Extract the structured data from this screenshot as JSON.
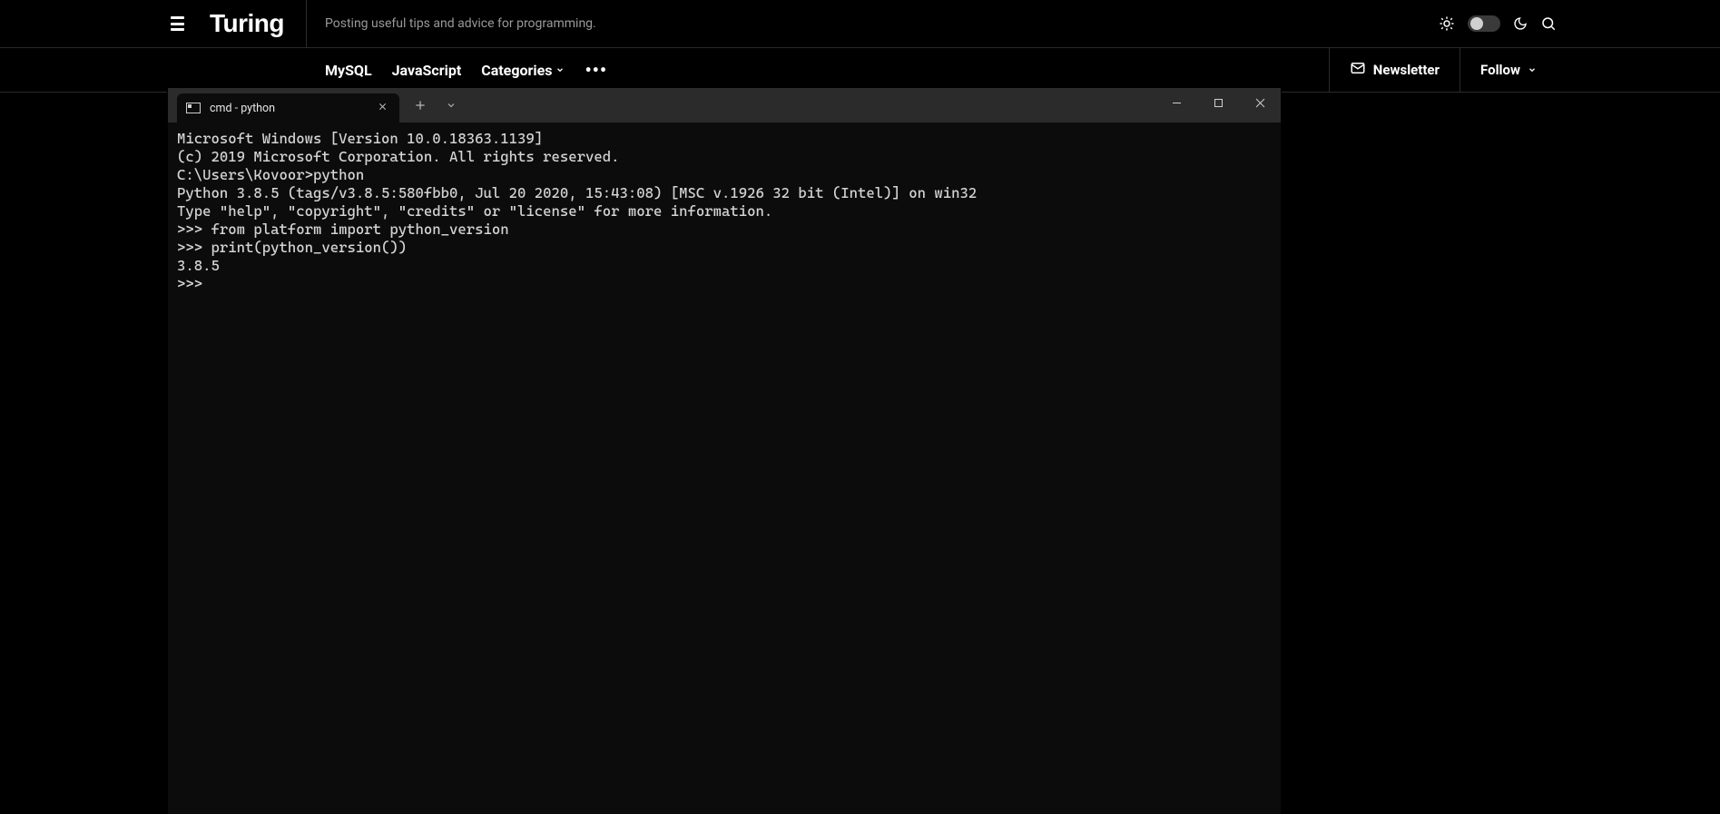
{
  "topbar": {
    "logo": "Turing",
    "tagline": "Posting useful tips and advice for programming."
  },
  "nav": {
    "items": [
      {
        "label": "MySQL",
        "has_caret": false
      },
      {
        "label": "JavaScript",
        "has_caret": false
      },
      {
        "label": "Categories",
        "has_caret": true
      }
    ],
    "more": "•••",
    "newsletter": "Newsletter",
    "follow": "Follow"
  },
  "terminal": {
    "tab_title": "cmd - python",
    "lines": [
      "Microsoft Windows [Version 10.0.18363.1139]",
      "(c) 2019 Microsoft Corporation. All rights reserved.",
      "",
      "C:\\Users\\Kovoor>python",
      "Python 3.8.5 (tags/v3.8.5:580fbb0, Jul 20 2020, 15:43:08) [MSC v.1926 32 bit (Intel)] on win32",
      "Type \"help\", \"copyright\", \"credits\" or \"license\" for more information.",
      ">>> from platform import python_version",
      ">>> print(python_version())",
      "3.8.5",
      ">>> "
    ]
  }
}
